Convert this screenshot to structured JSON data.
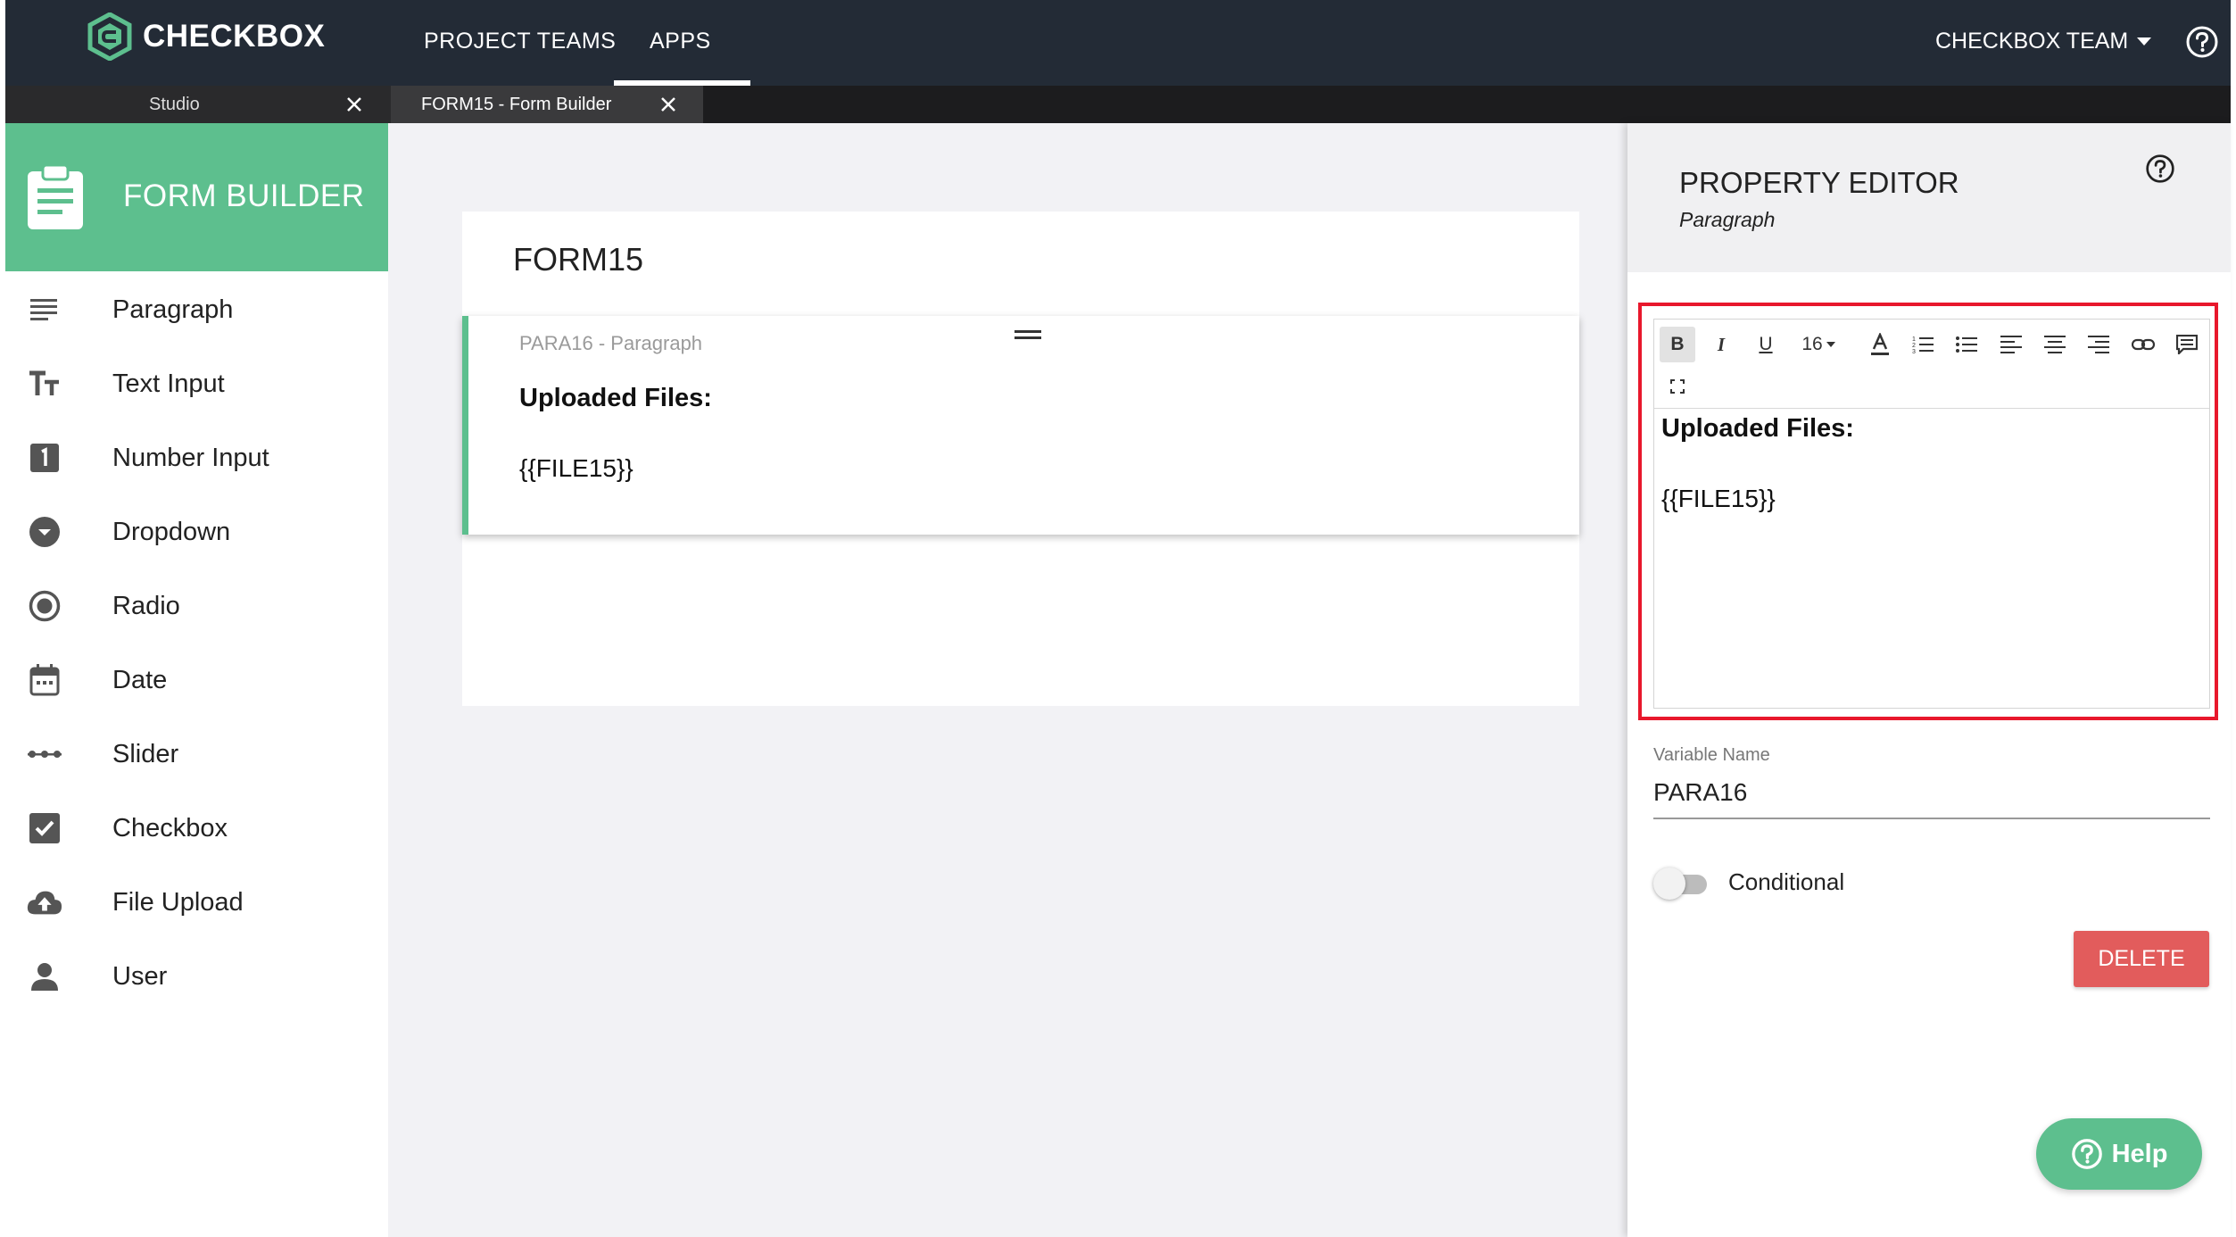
{
  "topbar": {
    "logo_text": "CHECKBOX",
    "nav": [
      {
        "label": "PROJECT TEAMS",
        "active": false
      },
      {
        "label": "APPS",
        "active": true
      }
    ],
    "team_menu": "CHECKBOX TEAM",
    "help_icon": "help-circle-icon"
  },
  "tabs": [
    {
      "label": "Studio",
      "active": false
    },
    {
      "label": "FORM15 - Form Builder",
      "active": true
    }
  ],
  "sidebar": {
    "title": "FORM BUILDER",
    "title_icon": "clipboard-icon",
    "items": [
      {
        "label": "Paragraph",
        "icon": "paragraph-icon"
      },
      {
        "label": "Text Input",
        "icon": "text-input-icon"
      },
      {
        "label": "Number Input",
        "icon": "number-input-icon"
      },
      {
        "label": "Dropdown",
        "icon": "dropdown-icon"
      },
      {
        "label": "Radio",
        "icon": "radio-icon"
      },
      {
        "label": "Date",
        "icon": "calendar-icon"
      },
      {
        "label": "Slider",
        "icon": "slider-icon"
      },
      {
        "label": "Checkbox",
        "icon": "checkbox-icon"
      },
      {
        "label": "File Upload",
        "icon": "cloud-upload-icon"
      },
      {
        "label": "User",
        "icon": "user-icon"
      }
    ]
  },
  "canvas": {
    "form_title": "FORM15",
    "paragraph_block": {
      "label": "PARA16 - Paragraph",
      "heading": "Uploaded Files:",
      "variable": "{{FILE15}}"
    }
  },
  "property_editor": {
    "title": "PROPERTY EDITOR",
    "subtitle": "Paragraph",
    "toolbar": {
      "bold": "B",
      "italic": "I",
      "underline": "U",
      "font_size": "16"
    },
    "content": {
      "heading": "Uploaded Files:",
      "variable": "{{FILE15}}"
    },
    "variable_name_label": "Variable Name",
    "variable_name_value": "PARA16",
    "conditional_label": "Conditional",
    "conditional_on": false,
    "delete_label": "DELETE"
  },
  "help_button": {
    "label": "Help"
  },
  "colors": {
    "topbar": "#232b36",
    "accent_green": "#5dbf8e",
    "delete_red": "#e25c5c",
    "highlight_red": "#e8182c",
    "canvas_bg": "#f2f2f5"
  }
}
